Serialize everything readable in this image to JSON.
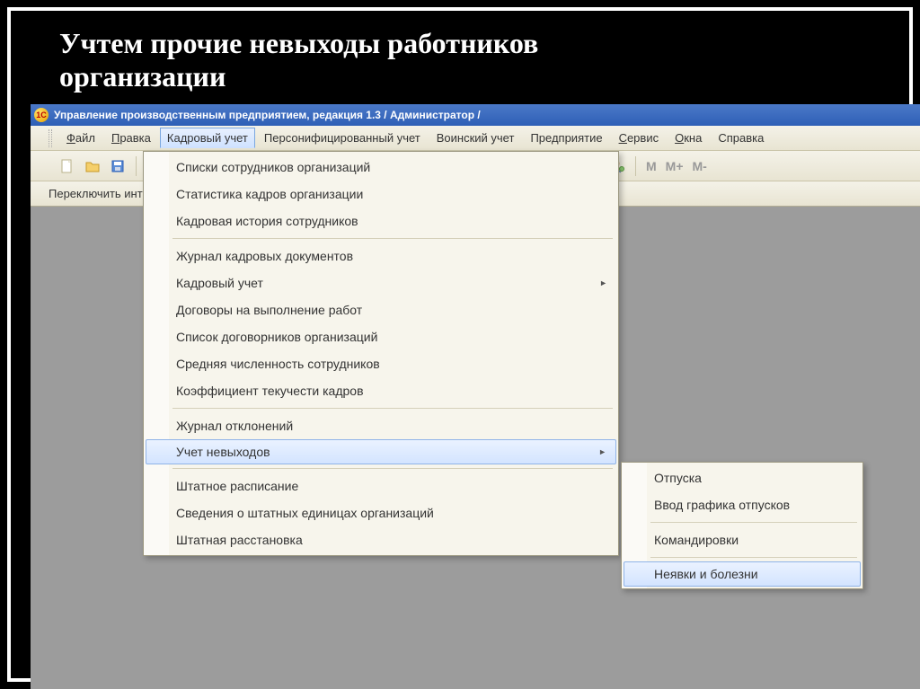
{
  "slide": {
    "title_line1": "Учтем прочие невыходы работников",
    "title_line2": "организации"
  },
  "window": {
    "title": "Управление производственным предприятием, редакция 1.3 / Администратор /"
  },
  "menubar": {
    "items": [
      {
        "label": "Файл",
        "ul": "Ф"
      },
      {
        "label": "Правка",
        "ul": "П"
      },
      {
        "label": "Кадровый учет",
        "ul": "",
        "active": true
      },
      {
        "label": "Персонифицированный учет",
        "ul": ""
      },
      {
        "label": "Воинский учет",
        "ul": ""
      },
      {
        "label": "Предприятие",
        "ul": ""
      },
      {
        "label": "Сервис",
        "ul": "С"
      },
      {
        "label": "Окна",
        "ul": "О"
      },
      {
        "label": "Справка",
        "ul": ""
      }
    ]
  },
  "toolbar": {
    "switch_label": "Переключить инте",
    "m1": "M",
    "m2": "M+",
    "m3": "M-"
  },
  "dropdown_main": {
    "items": [
      {
        "label": "Списки сотрудников организаций"
      },
      {
        "label": "Статистика кадров организации"
      },
      {
        "label": "Кадровая история сотрудников"
      },
      {
        "sep": true
      },
      {
        "label": "Журнал кадровых документов"
      },
      {
        "label": "Кадровый учет",
        "child": true
      },
      {
        "label": "Договоры на выполнение работ"
      },
      {
        "label": "Список договорников организаций"
      },
      {
        "label": "Средняя численность сотрудников"
      },
      {
        "label": "Коэффициент текучести кадров"
      },
      {
        "sep": true
      },
      {
        "label": "Журнал отклонений"
      },
      {
        "label": "Учет невыходов",
        "child": true,
        "highlight": true
      },
      {
        "sep": true
      },
      {
        "label": "Штатное расписание"
      },
      {
        "label": "Сведения о штатных единицах организаций"
      },
      {
        "label": "Штатная расстановка"
      }
    ]
  },
  "dropdown_sub": {
    "items": [
      {
        "label": "Отпуска"
      },
      {
        "label": "Ввод графика отпусков"
      },
      {
        "sep": true
      },
      {
        "label": "Командировки"
      },
      {
        "sep": true
      },
      {
        "label": "Неявки и болезни",
        "highlight": true
      }
    ]
  }
}
